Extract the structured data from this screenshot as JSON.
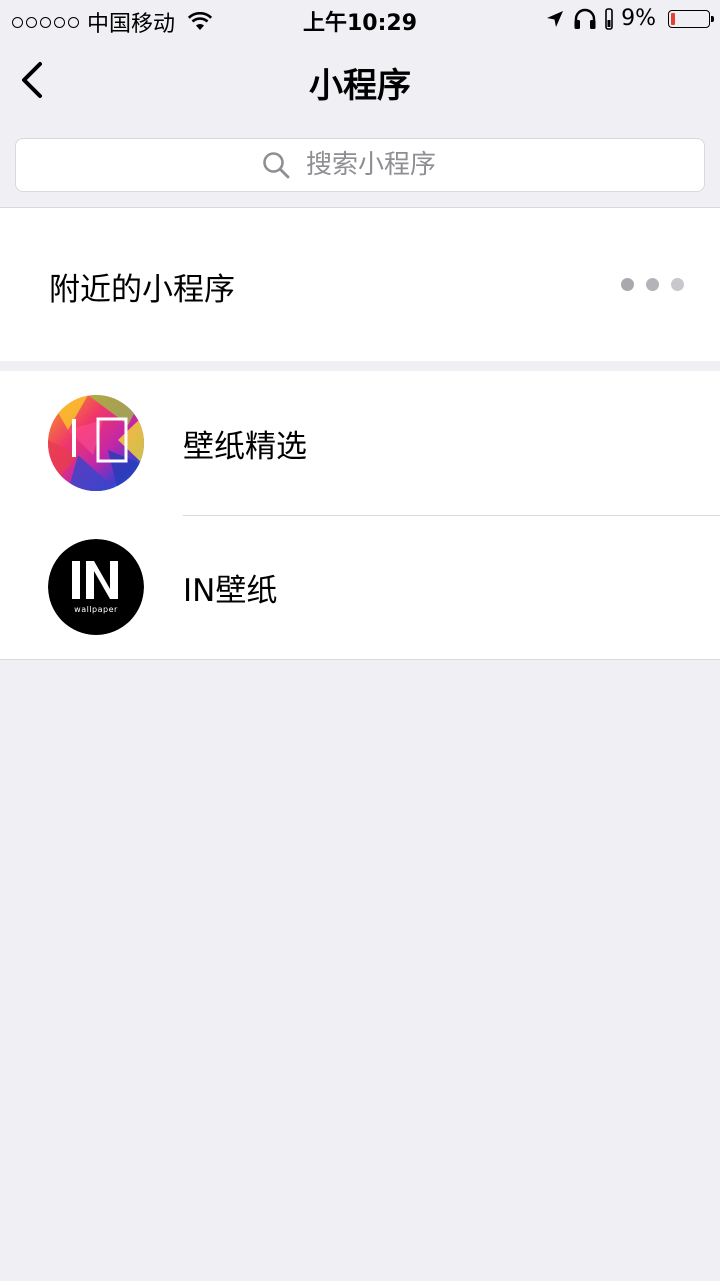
{
  "status_bar": {
    "carrier": "中国移动",
    "time": "上午10:29",
    "battery": "9%"
  },
  "nav": {
    "title": "小程序"
  },
  "search": {
    "placeholder": "搜索小程序"
  },
  "nearby": {
    "label": "附近的小程序"
  },
  "mini_programs": [
    {
      "name": "壁纸精选",
      "icon": "wallpaper-select-icon"
    },
    {
      "name": "IN壁纸",
      "icon": "in-wallpaper-icon",
      "icon_text": "wallpaper"
    }
  ],
  "colors": {
    "background": "#efeff4",
    "battery_low": "#e8402f"
  }
}
